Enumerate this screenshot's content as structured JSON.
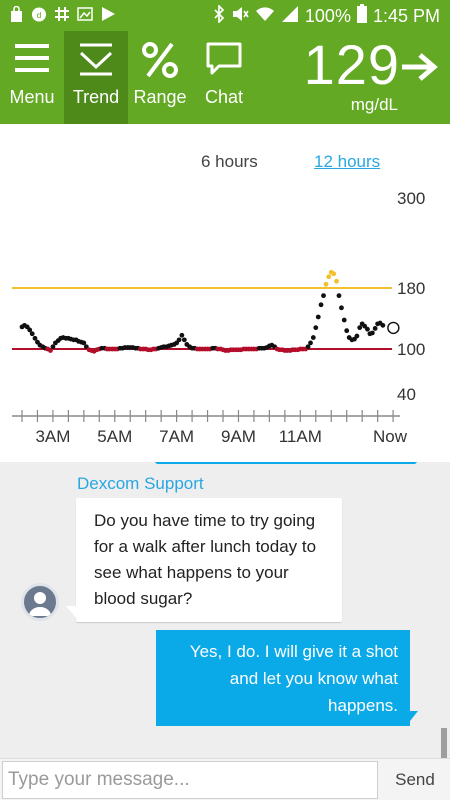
{
  "status_bar": {
    "battery": "100%",
    "time": "1:45 PM",
    "left_icons": [
      "shopping-bag-icon",
      "dexcom-logo-icon",
      "slack-icon",
      "image-off-icon",
      "play-store-icon"
    ],
    "right_icons": [
      "bluetooth-icon",
      "mute-icon",
      "wifi-icon",
      "signal-icon",
      "battery-icon"
    ]
  },
  "header": {
    "nav": [
      {
        "label": "Menu",
        "icon": "hamburger-menu-icon"
      },
      {
        "label": "Trend",
        "icon": "trend-icon",
        "active": true
      },
      {
        "label": "Range",
        "icon": "percent-icon"
      },
      {
        "label": "Chat",
        "icon": "chat-bubble-icon"
      }
    ],
    "glucose_value": "129",
    "glucose_unit": "mg/dL",
    "trend_arrow": "arrow-right-icon",
    "color": "#63a923",
    "active_color": "#4e8a1a"
  },
  "graph": {
    "tabs": [
      "6 hours",
      "12 hours"
    ],
    "selected_tab": "12 hours",
    "y_labels": [
      "300",
      "180",
      "100",
      "40"
    ],
    "x_labels": [
      "3AM",
      "5AM",
      "7AM",
      "9AM",
      "11AM",
      "Now"
    ],
    "high_threshold": 180,
    "low_threshold": 100,
    "high_color": "#f3c02d",
    "low_color": "#b30d2a",
    "point_color": "#111111"
  },
  "chart_data": {
    "type": "scatter",
    "x_unit": "hours",
    "x_range": [
      2,
      13.9
    ],
    "y_range": [
      40,
      300
    ],
    "series": [
      {
        "points": [
          [
            2.0,
            129
          ],
          [
            2.08,
            131
          ],
          [
            2.17,
            129
          ],
          [
            2.25,
            125
          ],
          [
            2.33,
            120
          ],
          [
            2.42,
            114
          ],
          [
            2.5,
            109
          ],
          [
            2.58,
            105
          ],
          [
            2.67,
            103
          ],
          [
            2.75,
            101
          ],
          [
            2.83,
            100
          ],
          [
            2.92,
            98
          ],
          [
            3.0,
            103
          ],
          [
            3.08,
            108
          ],
          [
            3.17,
            111
          ],
          [
            3.25,
            114
          ],
          [
            3.33,
            115
          ],
          [
            3.42,
            114
          ],
          [
            3.5,
            114
          ],
          [
            3.58,
            113
          ],
          [
            3.67,
            112
          ],
          [
            3.75,
            112
          ],
          [
            3.83,
            110
          ],
          [
            3.92,
            109
          ],
          [
            4.0,
            108
          ],
          [
            4.08,
            103
          ],
          [
            4.17,
            99
          ],
          [
            4.25,
            98
          ],
          [
            4.33,
            97
          ],
          [
            4.42,
            99
          ],
          [
            4.5,
            100
          ],
          [
            4.58,
            101
          ],
          [
            4.67,
            101
          ],
          [
            4.75,
            100
          ],
          [
            4.83,
            100
          ],
          [
            4.92,
            100
          ],
          [
            5.0,
            100
          ],
          [
            5.08,
            100
          ],
          [
            5.17,
            101
          ],
          [
            5.25,
            101
          ],
          [
            5.33,
            102
          ],
          [
            5.42,
            102
          ],
          [
            5.5,
            102
          ],
          [
            5.58,
            102
          ],
          [
            5.67,
            101
          ],
          [
            5.75,
            101
          ],
          [
            5.83,
            100
          ],
          [
            5.92,
            100
          ],
          [
            6.0,
            100
          ],
          [
            6.08,
            99
          ],
          [
            6.17,
            99
          ],
          [
            6.25,
            100
          ],
          [
            6.33,
            100
          ],
          [
            6.42,
            101
          ],
          [
            6.5,
            102
          ],
          [
            6.58,
            103
          ],
          [
            6.67,
            103
          ],
          [
            6.75,
            104
          ],
          [
            6.83,
            105
          ],
          [
            6.92,
            106
          ],
          [
            7.0,
            108
          ],
          [
            7.08,
            112
          ],
          [
            7.17,
            118
          ],
          [
            7.25,
            112
          ],
          [
            7.33,
            106
          ],
          [
            7.42,
            103
          ],
          [
            7.5,
            101
          ],
          [
            7.58,
            101
          ],
          [
            7.67,
            100
          ],
          [
            7.75,
            100
          ],
          [
            7.83,
            100
          ],
          [
            7.92,
            100
          ],
          [
            8.0,
            100
          ],
          [
            8.08,
            100
          ],
          [
            8.17,
            101
          ],
          [
            8.25,
            101
          ],
          [
            8.33,
            100
          ],
          [
            8.42,
            100
          ],
          [
            8.5,
            99
          ],
          [
            8.58,
            98
          ],
          [
            8.67,
            98
          ],
          [
            8.75,
            99
          ],
          [
            8.83,
            99
          ],
          [
            8.92,
            99
          ],
          [
            9.0,
            99
          ],
          [
            9.08,
            99
          ],
          [
            9.17,
            100
          ],
          [
            9.25,
            100
          ],
          [
            9.33,
            100
          ],
          [
            9.42,
            100
          ],
          [
            9.5,
            100
          ],
          [
            9.58,
            100
          ],
          [
            9.67,
            101
          ],
          [
            9.75,
            101
          ],
          [
            9.83,
            101
          ],
          [
            9.92,
            102
          ],
          [
            10.0,
            104
          ],
          [
            10.08,
            105
          ],
          [
            10.17,
            103
          ],
          [
            10.25,
            100
          ],
          [
            10.33,
            99
          ],
          [
            10.42,
            99
          ],
          [
            10.5,
            98
          ],
          [
            10.58,
            98
          ],
          [
            10.67,
            98
          ],
          [
            10.75,
            99
          ],
          [
            10.83,
            99
          ],
          [
            10.92,
            99
          ],
          [
            11.0,
            100
          ],
          [
            11.08,
            100
          ],
          [
            11.17,
            100
          ],
          [
            11.25,
            103
          ],
          [
            11.33,
            108
          ],
          [
            11.42,
            115
          ],
          [
            11.5,
            128
          ],
          [
            11.58,
            142
          ],
          [
            11.67,
            158
          ],
          [
            11.75,
            170
          ],
          [
            11.83,
            185
          ],
          [
            11.92,
            195
          ],
          [
            12.0,
            201
          ],
          [
            12.08,
            199
          ],
          [
            12.17,
            189
          ],
          [
            12.25,
            170
          ],
          [
            12.33,
            154
          ],
          [
            12.42,
            138
          ],
          [
            12.5,
            124
          ],
          [
            12.58,
            115
          ],
          [
            12.67,
            112
          ],
          [
            12.75,
            113
          ],
          [
            12.83,
            117
          ],
          [
            12.92,
            128
          ],
          [
            13.0,
            133
          ],
          [
            13.08,
            130
          ],
          [
            13.17,
            126
          ],
          [
            13.25,
            120
          ],
          [
            13.33,
            121
          ],
          [
            13.42,
            127
          ],
          [
            13.5,
            133
          ],
          [
            13.58,
            134
          ],
          [
            13.67,
            131
          ],
          [
            13.75,
            129
          ]
        ]
      }
    ]
  },
  "chat": {
    "sender": "Dexcom Support",
    "incoming_lines": [
      "Do you have time to try going",
      "for a walk after lunch today to",
      "see what happens to your",
      "blood sugar?"
    ],
    "outgoing_lines": [
      "Yes, I do. I will give it a shot",
      "and let you know what",
      "happens."
    ],
    "avatar_icon": "user-avatar-icon"
  },
  "composer": {
    "placeholder": "Type your message...",
    "send_label": "Send"
  }
}
